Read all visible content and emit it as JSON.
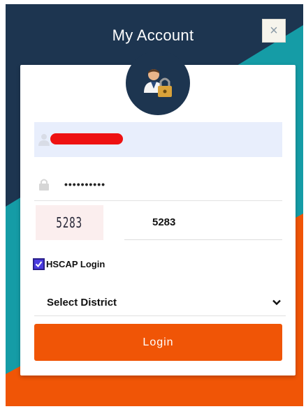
{
  "dialog": {
    "title": "My Account",
    "close_label": "×"
  },
  "form": {
    "username_value": "",
    "password_value": "••••••••••",
    "captcha_image_text": "5283",
    "captcha_value": "5283",
    "hscap_login_label": "HSCAP Login",
    "hscap_login_checked": true,
    "district_select_label": "Select District",
    "login_button_label": "Login"
  },
  "colors": {
    "navy": "#1d3550",
    "teal": "#159ca6",
    "orange": "#f05506",
    "username_bg": "#e8eefc",
    "redaction": "#ee1111"
  },
  "icons": {
    "avatar": "user-lock-icon",
    "username": "user-icon",
    "password": "lock-icon",
    "close": "close-icon",
    "district": "chevron-down-icon",
    "checkbox": "checkmark-icon"
  }
}
